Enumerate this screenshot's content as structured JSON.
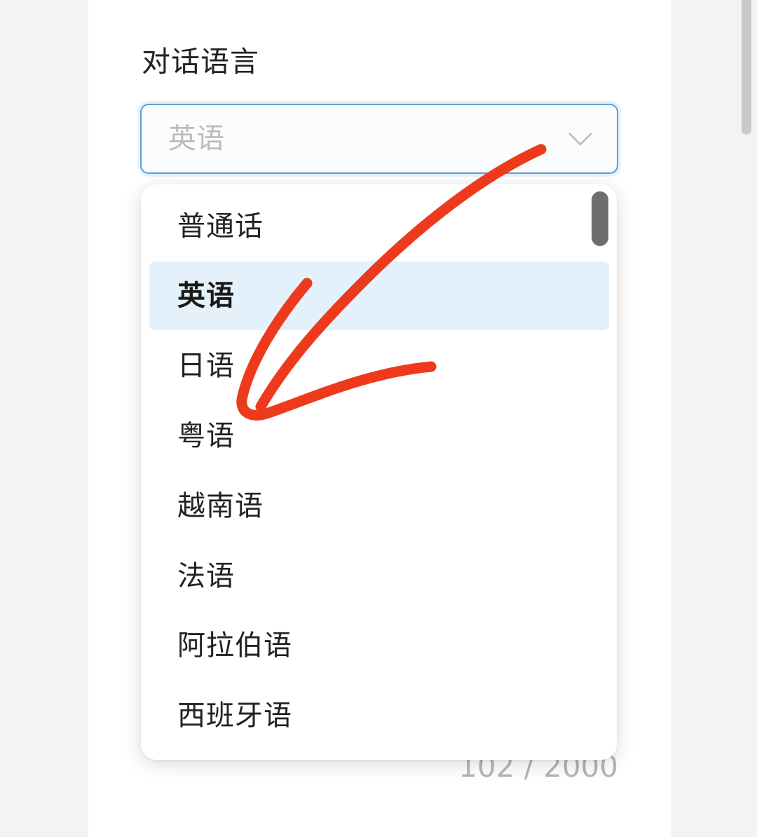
{
  "form": {
    "label": "对话语言",
    "select_value": "英语",
    "counter": "102 / 2000"
  },
  "dropdown": {
    "options": [
      {
        "label": "普通话",
        "selected": false
      },
      {
        "label": "英语",
        "selected": true
      },
      {
        "label": "日语",
        "selected": false
      },
      {
        "label": "粤语",
        "selected": false
      },
      {
        "label": "越南语",
        "selected": false
      },
      {
        "label": "法语",
        "selected": false
      },
      {
        "label": "阿拉伯语",
        "selected": false
      },
      {
        "label": "西班牙语",
        "selected": false
      }
    ]
  },
  "icons": {
    "select_indicator": "chevron-down-icon",
    "annotation": "hand-drawn-arrow-icon"
  },
  "colors": {
    "select_border": "#5b9fd4",
    "selected_option_bg": "#e4f1fb",
    "annotation_arrow": "#ee3a1c"
  }
}
